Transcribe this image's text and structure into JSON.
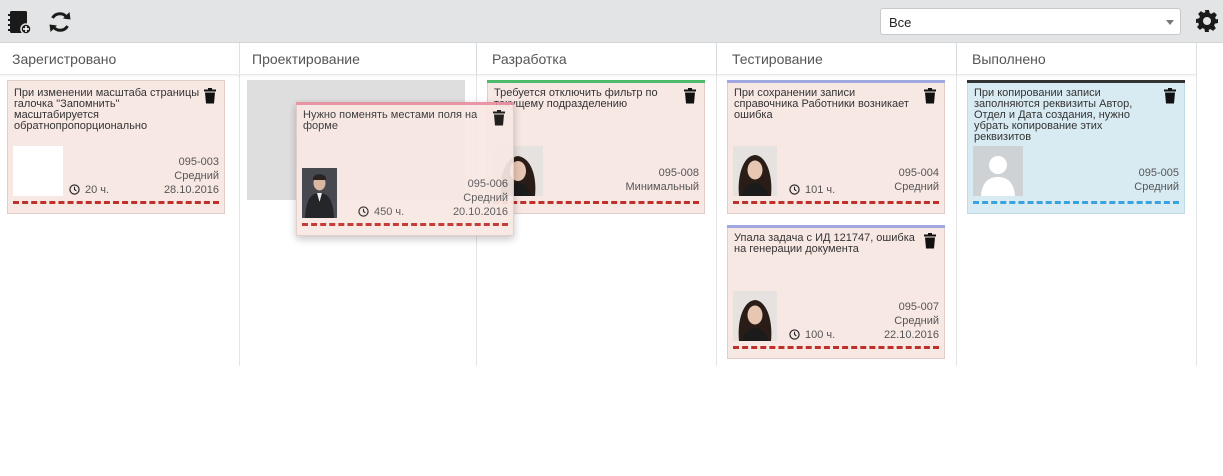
{
  "toolbar": {
    "icons": [
      "add-notebook-icon",
      "refresh-icon",
      "gear-icon"
    ],
    "filter_value": "Все"
  },
  "columns": [
    {
      "label": "Зарегистровано"
    },
    {
      "label": "Проектирование"
    },
    {
      "label": "Разработка"
    },
    {
      "label": "Тестирование"
    },
    {
      "label": "Выполнено"
    }
  ],
  "cards": {
    "c1": {
      "title": "При изменении масштаба страницы галочка \"Запомнить\" масштабируется обратнопропорционально",
      "hours": "20 ч.",
      "number": "095-003",
      "priority": "Средний",
      "date": "28.10.2016",
      "accent": "#c0302b",
      "avatar": "blank"
    },
    "c2": {
      "title": "Нужно поменять местами поля на форме",
      "hours": "450 ч.",
      "number": "095-006",
      "priority": "Средний",
      "date": "20.10.2016",
      "accent": "#e88fa0",
      "avatar": "man"
    },
    "c3": {
      "title": "Требуется отключить фильтр по текущему подразделению",
      "number": "095-008",
      "priority": "Минимальный",
      "accent": "#4cba6a",
      "avatar": "woman"
    },
    "c4": {
      "title": "При сохранении записи справочника Работники возникает ошибка",
      "hours": "101 ч.",
      "number": "095-004",
      "priority": "Средний",
      "accent": "#9fa8e0",
      "avatar": "woman"
    },
    "c5": {
      "title": "Упала задача с ИД 121747, ошибка на генерации документа",
      "hours": "100 ч.",
      "number": "095-007",
      "priority": "Средний",
      "date": "22.10.2016",
      "accent": "#9fa8e0",
      "avatar": "woman"
    },
    "c6": {
      "title": "При копировании записи заполняются реквизиты Автор, Отдел и Дата создания, нужно убрать копирование этих реквизитов",
      "number": "095-005",
      "priority": "Средний",
      "accent": "#333333",
      "avatar": "default-user"
    }
  }
}
